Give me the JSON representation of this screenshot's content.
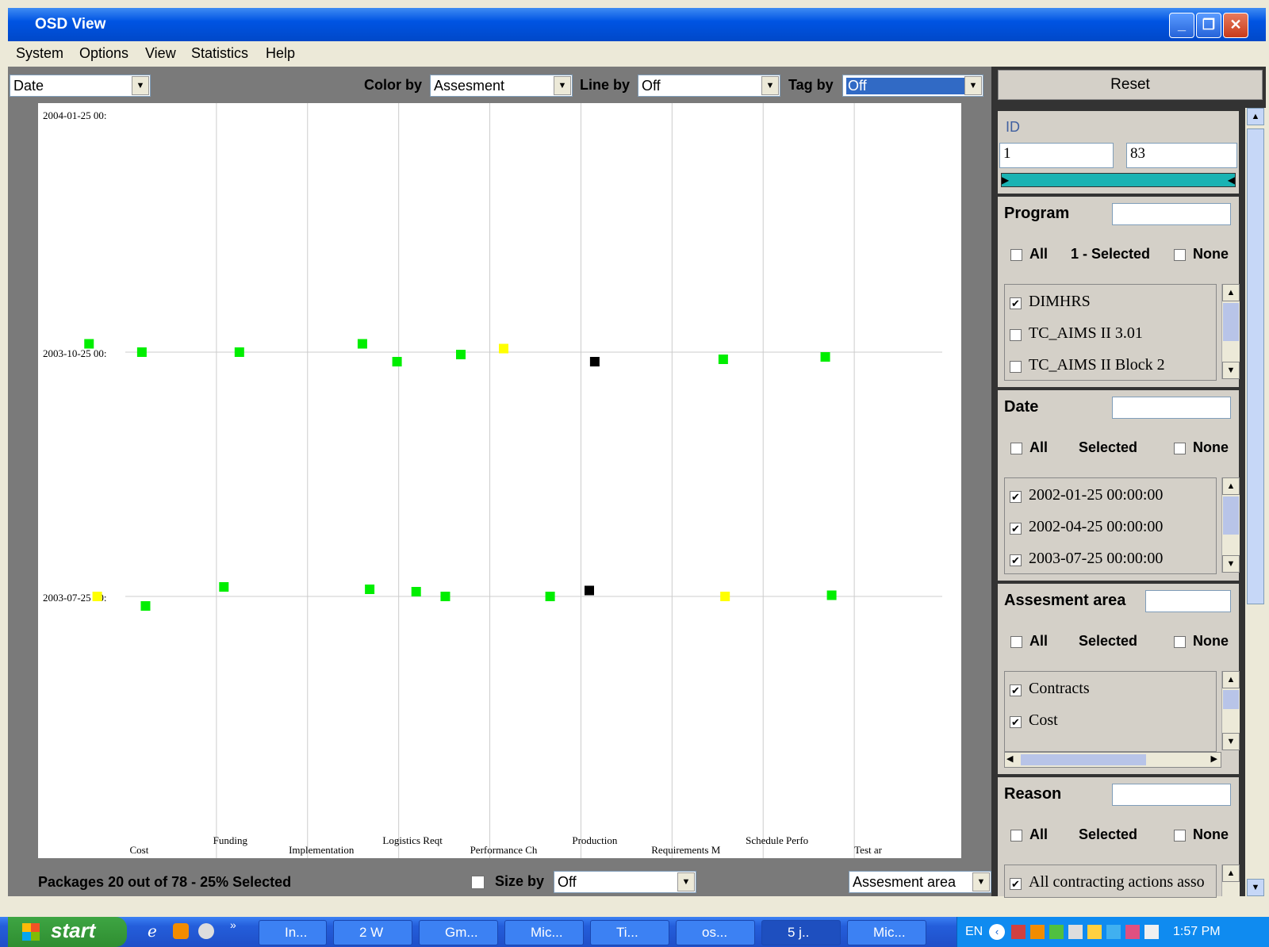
{
  "window": {
    "title": "OSD View"
  },
  "menu": [
    "System",
    "Options",
    "View",
    "Statistics",
    "Help"
  ],
  "toolbar": {
    "axis_select": "Date",
    "color_by_label": "Color by",
    "color_by_value": "Assesment",
    "line_by_label": "Line by",
    "line_by_value": "Off",
    "tag_by_label": "Tag by",
    "tag_by_value": "Off",
    "reset_label": "Reset"
  },
  "chart_data": {
    "type": "scatter",
    "y_ticks": [
      "2004-01-25 00:",
      "2003-10-25 00:",
      "2003-07-25 00:"
    ],
    "x_categories": [
      "Cost",
      "Funding",
      "Implementation",
      "Logistics Reqt",
      "Performance Ch",
      "Production",
      "Requirements M",
      "Schedule Perfo",
      "Test ar"
    ],
    "color_legend": {
      "green": "#00ee00",
      "yellow": "#ffff00",
      "black": "#000000"
    },
    "series": [
      {
        "date": "2003-10-25",
        "points": [
          {
            "category": "Cost",
            "jitter": -0.55,
            "y": 0.035,
            "color": "green"
          },
          {
            "category": "Cost",
            "jitter": 0.03,
            "y": 0.0,
            "color": "green"
          },
          {
            "category": "Funding",
            "jitter": 0.1,
            "y": 0.0,
            "color": "green"
          },
          {
            "category": "Logistics Reqt",
            "jitter": -0.55,
            "y": 0.035,
            "color": "green"
          },
          {
            "category": "Logistics Reqt",
            "jitter": -0.17,
            "y": -0.04,
            "color": "green"
          },
          {
            "category": "Performance Ch",
            "jitter": -0.47,
            "y": -0.01,
            "color": "green"
          },
          {
            "category": "Performance Ch",
            "jitter": 0.0,
            "y": 0.015,
            "color": "yellow"
          },
          {
            "category": "Production",
            "jitter": 0.0,
            "y": -0.04,
            "color": "black"
          },
          {
            "category": "Requirements M",
            "jitter": 0.41,
            "y": -0.03,
            "color": "green"
          },
          {
            "category": "Schedule Perfo",
            "jitter": 0.53,
            "y": -0.02,
            "color": "green"
          }
        ]
      },
      {
        "date": "2003-07-25",
        "points": [
          {
            "category": "Cost",
            "jitter": -0.46,
            "y": 0.0,
            "color": "yellow"
          },
          {
            "category": "Cost",
            "jitter": 0.07,
            "y": -0.04,
            "color": "green"
          },
          {
            "category": "Funding",
            "jitter": -0.07,
            "y": 0.04,
            "color": "green"
          },
          {
            "category": "Logistics Reqt",
            "jitter": -0.47,
            "y": 0.03,
            "color": "green"
          },
          {
            "category": "Logistics Reqt",
            "jitter": 0.04,
            "y": 0.02,
            "color": "green"
          },
          {
            "category": "Logistics Reqt",
            "jitter": 0.36,
            "y": 0.0,
            "color": "green"
          },
          {
            "category": "Performance Ch",
            "jitter": 0.51,
            "y": 0.0,
            "color": "green"
          },
          {
            "category": "Production",
            "jitter": -0.06,
            "y": 0.025,
            "color": "black"
          },
          {
            "category": "Requirements M",
            "jitter": 0.43,
            "y": 0.0,
            "color": "yellow"
          },
          {
            "category": "Schedule Perfo",
            "jitter": 0.6,
            "y": 0.005,
            "color": "green"
          }
        ]
      }
    ]
  },
  "status": {
    "packages_text": "Packages 20 out of 78  -  25% Selected",
    "size_by_label": "Size by",
    "size_by_value": "Off",
    "group_select": "Assesment area"
  },
  "filters": {
    "id": {
      "title": "ID",
      "min": "1",
      "max": "83"
    },
    "program": {
      "title": "Program",
      "all": "All",
      "selected": "1 - Selected",
      "none": "None",
      "items": [
        {
          "label": "DIMHRS",
          "checked": true
        },
        {
          "label": "TC_AIMS II 3.01",
          "checked": false
        },
        {
          "label": "TC_AIMS II Block 2",
          "checked": false
        }
      ]
    },
    "date": {
      "title": "Date",
      "all": "All",
      "selected": "Selected",
      "none": "None",
      "items": [
        {
          "label": "2002-01-25 00:00:00",
          "checked": true
        },
        {
          "label": "2002-04-25 00:00:00",
          "checked": true
        },
        {
          "label": "2003-07-25 00:00:00",
          "checked": true
        }
      ]
    },
    "assesment": {
      "title": "Assesment area",
      "all": "All",
      "selected": "Selected",
      "none": "None",
      "items": [
        {
          "label": "Contracts",
          "checked": true
        },
        {
          "label": "Cost",
          "checked": true
        }
      ]
    },
    "reason": {
      "title": "Reason",
      "all": "All",
      "selected": "Selected",
      "none": "None",
      "items": [
        {
          "label": "All contracting actions asso",
          "checked": true
        }
      ]
    }
  },
  "taskbar": {
    "start": "start",
    "items": [
      "In...",
      "2 W",
      "Gm...",
      "Mic...",
      "Ti...",
      "os...",
      "5 j..",
      "Mic..."
    ],
    "lang": "EN",
    "clock": "1:57 PM"
  }
}
